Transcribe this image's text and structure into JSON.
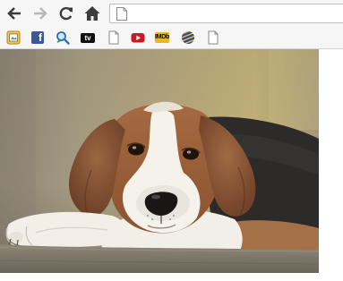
{
  "toolbar": {
    "back_icon": "back-arrow-icon",
    "forward_icon": "forward-arrow-icon",
    "reload_icon": "reload-icon",
    "home_icon": "home-icon",
    "address": {
      "value": "",
      "icon": "page-icon"
    }
  },
  "bookmarks": [
    {
      "icon": "scan-icon"
    },
    {
      "icon": "facebook-icon",
      "glyph": "f"
    },
    {
      "icon": "search-magnifier-icon"
    },
    {
      "icon": "tv-icon",
      "glyph": "tv"
    },
    {
      "icon": "page-icon"
    },
    {
      "icon": "youtube-icon"
    },
    {
      "icon": "imdb-icon",
      "glyph": "IMDb"
    },
    {
      "icon": "striped-ball-icon"
    },
    {
      "icon": "page-icon"
    }
  ],
  "content": {
    "image": "beagle-puppy-photo"
  },
  "colors": {
    "toolbar_bg": "#f6f6f6",
    "facebook": "#3b5998",
    "youtube": "#cc181e",
    "imdb": "#e6b91e"
  }
}
